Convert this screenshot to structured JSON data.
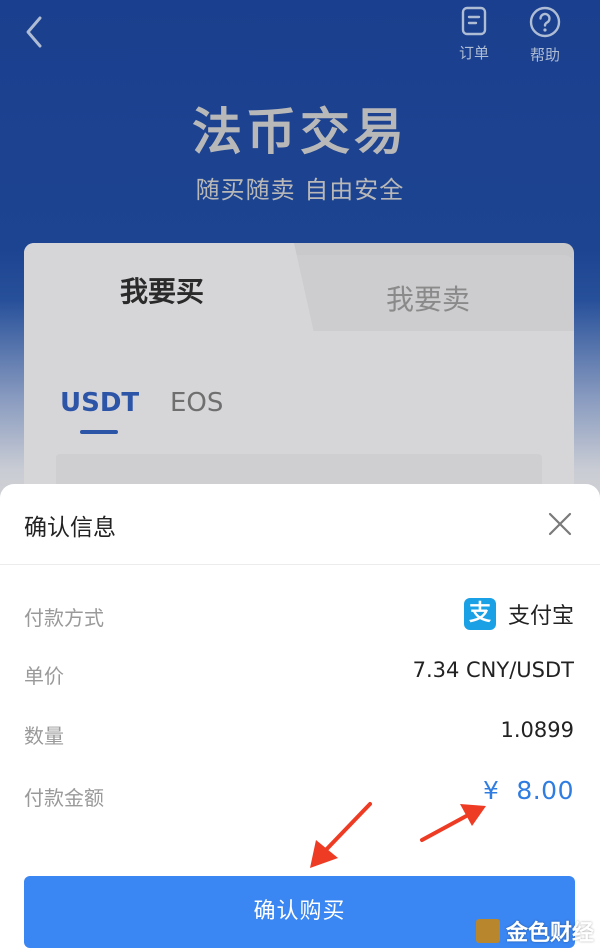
{
  "nav": {
    "orders_label": "订单",
    "help_label": "帮助"
  },
  "hero": {
    "title": "法币交易",
    "subtitle": "随买随卖 自由安全"
  },
  "card": {
    "tab_buy": "我要买",
    "tab_sell": "我要卖",
    "coins": [
      "USDT",
      "EOS"
    ],
    "selected_coin": "USDT"
  },
  "sheet": {
    "title": "确认信息",
    "rows": {
      "payment_method_label": "付款方式",
      "payment_method_value": "支付宝",
      "price_label": "单价",
      "price_value": "7.34 CNY/USDT",
      "quantity_label": "数量",
      "quantity_value": "1.0899",
      "amount_label": "付款金额",
      "amount_value": "¥  8.00"
    },
    "confirm_label": "确认购买"
  },
  "watermark": {
    "text": "金色财经"
  },
  "colors": {
    "accent_blue": "#3a86f2",
    "amount_blue": "#2f7de1",
    "header_blue": "#1d4491",
    "alipay_blue": "#1aa1e5",
    "annotation_red": "#ee3b24"
  },
  "icons": {
    "back": "chevron-left-icon",
    "orders": "document-icon",
    "help": "question-circle-icon",
    "close": "close-icon",
    "alipay": "alipay-icon"
  }
}
